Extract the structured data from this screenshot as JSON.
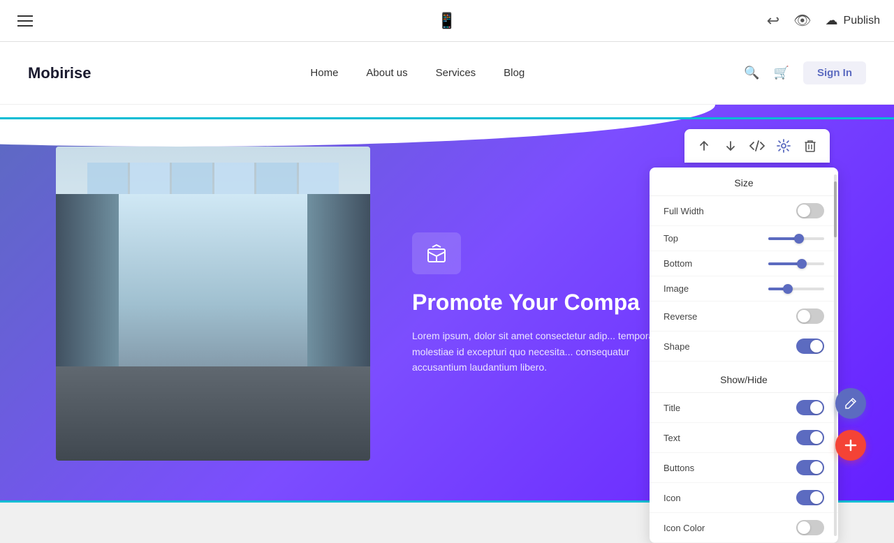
{
  "toolbar": {
    "publish_label": "Publish",
    "undo_label": "Undo",
    "preview_label": "Preview"
  },
  "navbar": {
    "logo": "Mobirise",
    "links": [
      "Home",
      "About us",
      "Services",
      "Blog"
    ],
    "signin_label": "Sign In"
  },
  "hero": {
    "title": "Promote Your Compa",
    "body": "Lorem ipsum, dolor sit amet consectetur adip... tempora molestiae id excepturi quo necesita... consequatur accusantium laudantium libero.",
    "icon": "◻"
  },
  "block_controls": {
    "up_label": "Move Up",
    "down_label": "Move Down",
    "code_label": "Code",
    "settings_label": "Settings",
    "delete_label": "Delete"
  },
  "settings_panel": {
    "size_title": "Size",
    "full_width_label": "Full Width",
    "full_width_on": false,
    "top_label": "Top",
    "top_value": 55,
    "bottom_label": "Bottom",
    "bottom_value": 60,
    "image_label": "Image",
    "image_value": 35,
    "reverse_label": "Reverse",
    "reverse_on": false,
    "shape_label": "Shape",
    "shape_on": true,
    "show_hide_title": "Show/Hide",
    "title_label": "Title",
    "title_on": true,
    "text_label": "Text",
    "text_on": true,
    "buttons_label": "Buttons",
    "buttons_on": true,
    "icon_label": "Icon",
    "icon_on": true,
    "icon_color_label": "Icon Color",
    "icon_color_on": false
  },
  "fabs": {
    "edit_icon": "✏",
    "add_icon": "+"
  }
}
